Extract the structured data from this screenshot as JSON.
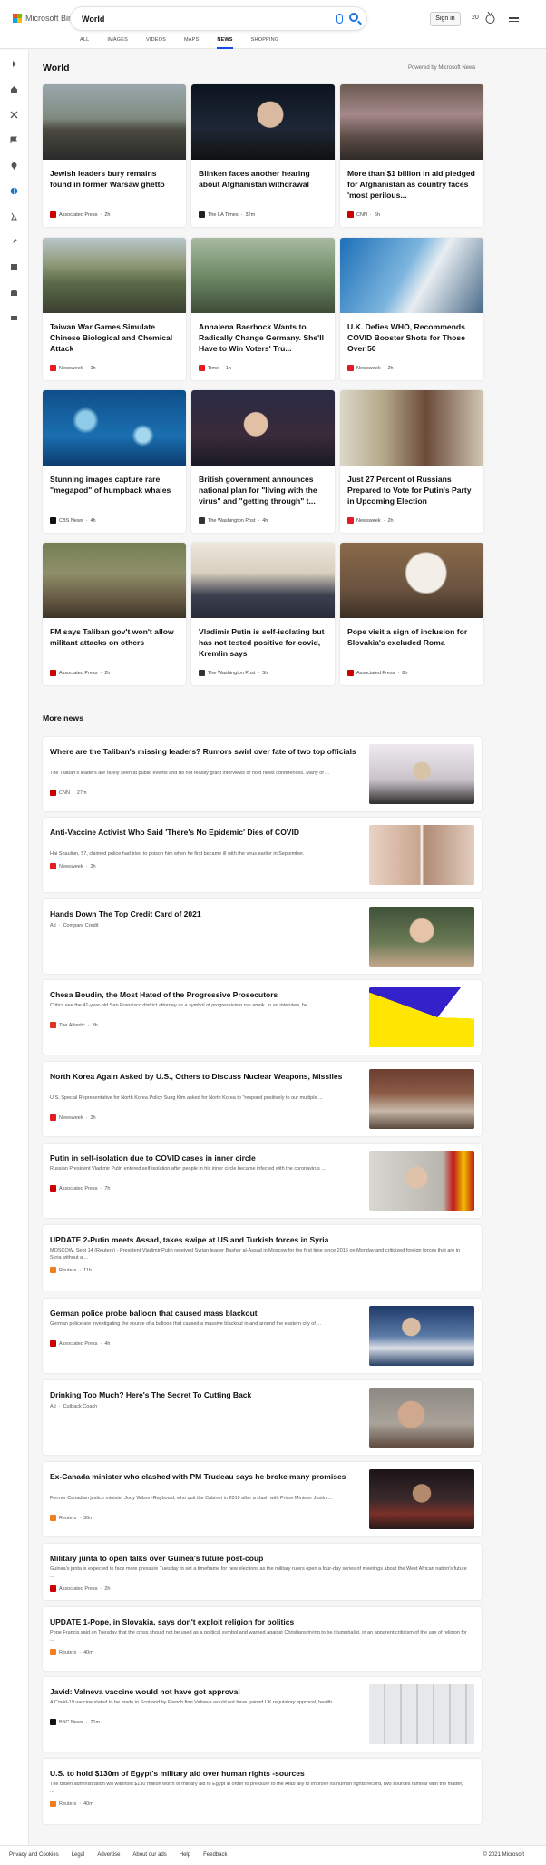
{
  "header": {
    "logo": "Microsoft Bing",
    "search_value": "World",
    "signin": "Sign in",
    "rewards": "20"
  },
  "tabs": [
    "ALL",
    "IMAGES",
    "VIDEOS",
    "MAPS",
    "NEWS",
    "SHOPPING"
  ],
  "active_tab": "NEWS",
  "sidebar_icons": [
    "collapse-icon",
    "home-icon",
    "tools-icon",
    "flag-icon",
    "location-icon",
    "globe-icon",
    "science-icon",
    "rocket-icon",
    "entertainment-icon",
    "building-icon",
    "money-icon"
  ],
  "section": {
    "title": "World",
    "powered": "Powered by Microsoft News"
  },
  "cards": [
    {
      "title": "Jewish leaders bury remains found in former Warsaw ghetto",
      "source": "Associated Press",
      "age": "2h",
      "src_color": "#c00",
      "img": "funeral"
    },
    {
      "title": "Blinken faces another hearing about Afghanistan withdrawal",
      "source": "The LA Times",
      "age": "32m",
      "src_color": "#222",
      "img": "blinken"
    },
    {
      "title": "More than $1 billion in aid pledged for Afghanistan as country faces 'most perilous...",
      "source": "CNN",
      "age": "6h",
      "src_color": "#cc0000",
      "img": "market"
    },
    {
      "title": "Taiwan War Games Simulate Chinese Biological and Chemical Attack",
      "source": "Newsweek",
      "age": "1h",
      "src_color": "#e51b23",
      "img": "tank"
    },
    {
      "title": "Annalena Baerbock Wants to Radically Change Germany. She'll Have to Win Voters' Tru...",
      "source": "Time",
      "age": "1h",
      "src_color": "#e51b23",
      "img": "military"
    },
    {
      "title": "U.K. Defies WHO, Recommends COVID Booster Shots for Those Over 50",
      "source": "Newsweek",
      "age": "2h",
      "src_color": "#e51b23",
      "img": "covid"
    },
    {
      "title": "Stunning images capture rare \"megapod\" of humpback whales",
      "source": "CBS News",
      "age": "4h",
      "src_color": "#111",
      "img": "ocean"
    },
    {
      "title": "British government announces national plan for \"living with the virus\" and \"getting through\" t...",
      "source": "The Washington Post",
      "age": "4h",
      "src_color": "#333",
      "img": "speaker"
    },
    {
      "title": "Just 27 Percent of Russians Prepared to Vote for Putin's Party in Upcoming Election",
      "source": "Newsweek",
      "age": "2h",
      "src_color": "#e51b23",
      "img": "poster"
    },
    {
      "title": "FM says Taliban gov't won't allow militant attacks on others",
      "source": "Associated Press",
      "age": "2h",
      "src_color": "#c00",
      "img": "camp"
    },
    {
      "title": "Vladimir Putin is self-isolating but has not tested positive for covid, Kremlin says",
      "source": "The Washington Post",
      "age": "5h",
      "src_color": "#333",
      "img": "handshake"
    },
    {
      "title": "Pope visit a sign of inclusion for Slovakia's excluded Roma",
      "source": "Associated Press",
      "age": "8h",
      "src_color": "#c00",
      "img": "pope"
    }
  ],
  "more": {
    "title": "More news",
    "items": [
      {
        "title": "Where are the Taliban's missing leaders? Rumors swirl over fate of two top officials",
        "snippet": "The Taliban's leaders are rarely seen at public events and do not readily grant interviews or hold news conferences. Many of ...",
        "source": "CNN",
        "age": "27m",
        "src_color": "#cc0000",
        "img": "taliban"
      },
      {
        "title": "Anti-Vaccine Activist Who Said 'There's No Epidemic' Dies of COVID",
        "snippet": "Hai Shaulian, 57, claimed police had tried to poison him when he first became ill with the virus earlier in September.",
        "source": "Newsweek",
        "age": "2h",
        "src_color": "#e51b23",
        "img": "faces"
      },
      {
        "title": "Hands Down The Top Credit Card of 2021",
        "snippet": "",
        "source": "Compare Credit",
        "age": "",
        "ad": "Ad",
        "src_color": "",
        "img": "woman"
      },
      {
        "title": "Chesa Boudin, the Most Hated of the Progressive Prosecutors",
        "snippet": "Critics see the 41-year-old San Francisco district attorney as a symbol of progressivism run amok. In an interview, he ...",
        "source": "The Atlantic",
        "age": "3h",
        "src_color": "#d32",
        "img": "boudin"
      },
      {
        "title": "North Korea Again Asked by U.S., Others to Discuss Nuclear Weapons, Missiles",
        "snippet": "U.S. Special Representative for North Korea Policy Sung Kim asked for North Korea to \"respond positively to our multiple ...",
        "source": "Newsweek",
        "age": "2h",
        "src_color": "#e51b23",
        "img": "meeting"
      },
      {
        "title": "Putin in self-isolation due to COVID cases in inner circle",
        "snippet": "Russian President Vladimir Putin entered self-isolation after people in his inner circle became infected with the coronavirus ...",
        "source": "Associated Press",
        "age": "7h",
        "src_color": "#c00",
        "img": "putin"
      },
      {
        "title": "UPDATE 2-Putin meets Assad, takes swipe at US and Turkish forces in Syria",
        "snippet": "MOSCOW, Sept 14 (Reuters) - President Vladimir Putin received Syrian leader Bashar al-Assad in Moscow for the first time since 2015 on Monday and criticized foreign forces that are in Syria without a ...",
        "source": "Reuters",
        "age": "11h",
        "src_color": "#f08020",
        "img": ""
      },
      {
        "title": "German police probe balloon that caused mass blackout",
        "snippet": "German police are investigating the source of a balloon that caused a massive blackout in and around the eastern city of ...",
        "source": "Associated Press",
        "age": "4h",
        "src_color": "#c00",
        "img": "police"
      },
      {
        "title": "Drinking Too Much? Here's The Secret To Cutting Back",
        "snippet": "",
        "source": "Cutback Coach",
        "age": "",
        "ad": "Ad",
        "src_color": "",
        "img": "drink"
      },
      {
        "title": "Ex-Canada minister who clashed with PM Trudeau says he broke many promises",
        "snippet": "Former Canadian justice minister Jody Wilson-Raybould, who quit the Cabinet in 2019 after a clash with Prime Minister Justin ...",
        "source": "Reuters",
        "age": "30m",
        "src_color": "#f08020",
        "img": "crowd"
      },
      {
        "title": "Military junta to open talks over Guinea's future post-coup",
        "snippet": "Guinea's junta is expected to face more pressure Tuesday to set a timeframe for new elections as the military rulers open a four-day series of meetings about the West African nation's future ...",
        "source": "Associated Press",
        "age": "2h",
        "src_color": "#c00",
        "img": ""
      },
      {
        "title": "UPDATE 1-Pope, in Slovakia, says don't exploit religion for politics",
        "snippet": "Pope Francis said on Tuesday that the cross should not be used as a political symbol and warned against Christians trying to be triumphalist, in an apparent criticism of the use of religion for ...",
        "source": "Reuters",
        "age": "40m",
        "src_color": "#f08020",
        "img": ""
      },
      {
        "title": "Javid: Valneva vaccine would not have got approval",
        "snippet": "A Covid-19 vaccine slated to be made in Scotland by French firm Valneva would not have gained UK regulatory approval, health ...",
        "source": "BBC News",
        "age": "21m",
        "src_color": "#111",
        "img": "vaccine"
      },
      {
        "title": "U.S. to hold $130m of Egypt's military aid over human rights -sources",
        "snippet": "The Biden administration will withhold $130 million worth of military aid to Egypt in order to pressure to the Arab ally to improve its human rights record, two sources familiar with the matter, ...",
        "source": "Reuters",
        "age": "40m",
        "src_color": "#f08020",
        "img": ""
      }
    ]
  },
  "footer": {
    "links": [
      "Privacy and Cookies",
      "Legal",
      "Advertise",
      "About our ads",
      "Help",
      "Feedback"
    ],
    "copyright": "© 2021 Microsoft"
  }
}
